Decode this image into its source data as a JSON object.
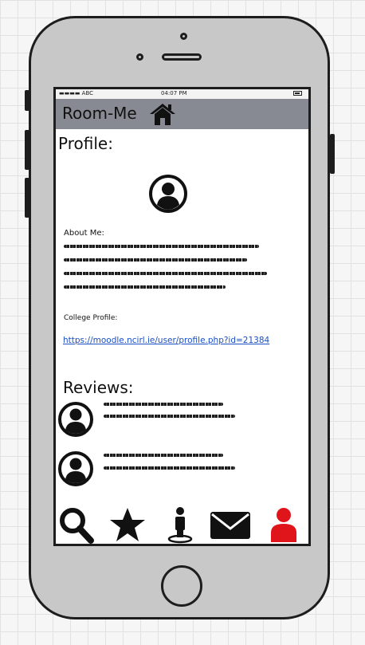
{
  "status_bar": {
    "carrier": "▬▬▬▬ ABC",
    "time": "04:07 PM"
  },
  "app": {
    "title": "Room-Me",
    "home_icon": "home-icon"
  },
  "profile": {
    "heading": "Profile:",
    "avatar_icon": "user-circle-icon",
    "about_label": "About Me:",
    "college_label": "College Profile:",
    "college_link": "https://moodle.ncirl.ie/user/profile.php?id=21384"
  },
  "reviews": {
    "heading": "Reviews:",
    "items": [
      {
        "avatar_icon": "user-circle-icon"
      },
      {
        "avatar_icon": "user-circle-icon"
      }
    ]
  },
  "tabbar": {
    "tabs": [
      {
        "icon": "search-icon"
      },
      {
        "icon": "star-icon"
      },
      {
        "icon": "person-location-icon"
      },
      {
        "icon": "mail-icon"
      },
      {
        "icon": "profile-icon",
        "active": true
      }
    ]
  },
  "colors": {
    "appbar": "#878a92",
    "active_tab": "#e0151b",
    "icon": "#111111",
    "link": "#1a4fc4",
    "device_body": "#c8c8c8"
  }
}
